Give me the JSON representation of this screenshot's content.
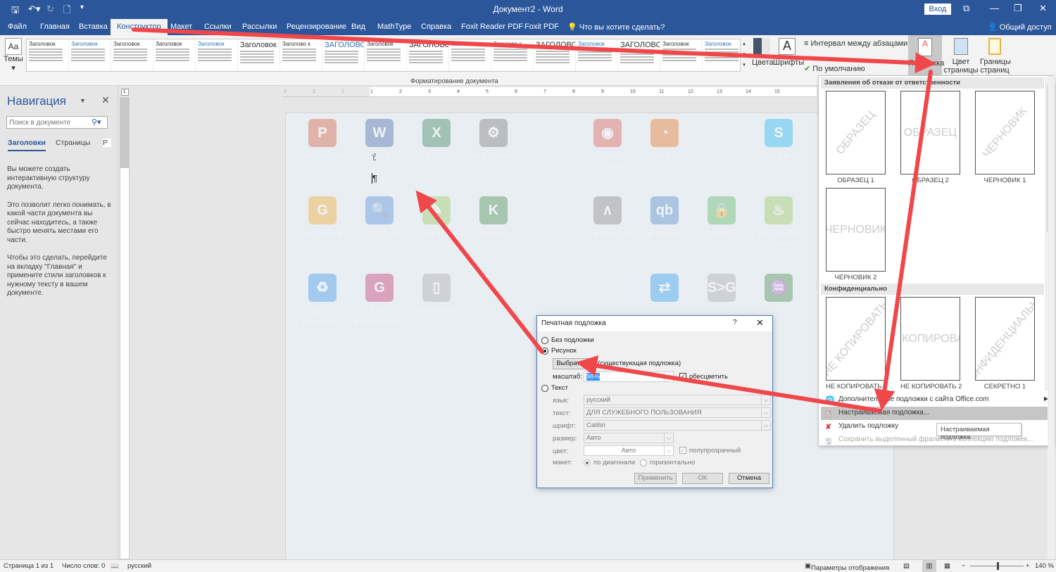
{
  "titlebar": {
    "title": "Документ2 - Word",
    "login": "Вход"
  },
  "tabs": [
    {
      "label": "Файл"
    },
    {
      "label": "Главная"
    },
    {
      "label": "Вставка"
    },
    {
      "label": "Конструктор",
      "active": true
    },
    {
      "label": "Макет"
    },
    {
      "label": "Ссылки"
    },
    {
      "label": "Рассылки"
    },
    {
      "label": "Рецензирование"
    },
    {
      "label": "Вид"
    },
    {
      "label": "MathType"
    },
    {
      "label": "Справка"
    },
    {
      "label": "Foxit Reader PDF"
    },
    {
      "label": "Foxit PDF"
    }
  ],
  "tell_me": "Что вы хотите сделать?",
  "share": "Общий доступ",
  "ribbon": {
    "themes": "Темы",
    "style_gallery": [
      "Заголовок",
      "Заголовок",
      "Заголовок",
      "Заголовок",
      "Заголовок",
      "Заголовок",
      "Заголово к",
      "ЗАГОЛОВО К",
      "Заголовок",
      "ЗАГОЛОВОК",
      "Заголовок",
      "Заголово к",
      "ЗАГОЛОВОК",
      "Заголовок",
      "ЗАГОЛОВОК",
      "Заголовок",
      "Заголовок"
    ],
    "colors": "Цвета",
    "fonts": "Шрифты",
    "paragraph_spacing": "Интервал между абзацами",
    "set_default": "По умолчанию",
    "watermark": "Подложка",
    "page_color": "Цвет страницы",
    "page_borders": "Границы страниц",
    "group_label": "Форматирование документа"
  },
  "nav": {
    "title": "Навигация",
    "search_placeholder": "Поиск в документе",
    "tabs": [
      "Заголовки",
      "Страницы",
      "Р"
    ],
    "help": [
      "Вы можете создать интерактивную структуру документа.",
      "Это позволит легко понимать, в какой части документа вы сейчас находитесь, а также быстро менять местами его части.",
      "Чтобы это сделать, перейдите на вкладку \"Главная\" и примените стили заголовков к нужному тексту в вашем документе."
    ]
  },
  "ruler_numbers": [
    "3",
    "2",
    "1",
    "1",
    "2",
    "3",
    "4",
    "5",
    "6",
    "7",
    "8",
    "9",
    "10",
    "11",
    "12",
    "13",
    "14",
    "15"
  ],
  "desktop_icons": [
    {
      "label": "PowerPoint",
      "glyph": "P",
      "color": "#d24726"
    },
    {
      "label": "Word",
      "glyph": "W",
      "color": "#2b579a"
    },
    {
      "label": "Excel",
      "glyph": "X",
      "color": "#217346"
    },
    {
      "label": "AirExplorer",
      "glyph": "⚙",
      "color": "#666666"
    },
    {
      "label": "Google Chrome",
      "glyph": "◉",
      "color": "#db4437"
    },
    {
      "label": "Firefox",
      "glyph": "◔",
      "color": "#e66000"
    },
    {
      "label": "Skype",
      "glyph": "S",
      "color": "#00aff0"
    },
    {
      "label": "Foxit Reader",
      "glyph": "G",
      "color": "#f39c12"
    },
    {
      "label": "STDU Viewer",
      "glyph": "🔍",
      "color": "#3b7dd8"
    },
    {
      "label": "Notepad",
      "glyph": "✎",
      "color": "#8bc34a"
    },
    {
      "label": "Kearan",
      "glyph": "K",
      "color": "#2e7d32"
    },
    {
      "label": "Graphing Calc",
      "glyph": "∧",
      "color": "#777777"
    },
    {
      "label": "qBittorrent",
      "glyph": "qb",
      "color": "#3a78c3"
    },
    {
      "label": "WinSCP",
      "glyph": "🔒",
      "color": "#4caf50"
    },
    {
      "label": "NETGEAR Genie",
      "glyph": "♨",
      "color": "#8bc34a"
    },
    {
      "label": "Wise Program...",
      "glyph": "♻",
      "color": "#1e88e5"
    },
    {
      "label": "Foxit PhantomPDF",
      "glyph": "G",
      "color": "#c2185b"
    },
    {
      "label": "LibreOffice 6.3",
      "glyph": "▯",
      "color": "#9e9e9e"
    },
    {
      "label": "",
      "glyph": "⇄",
      "color": "#0e8ee9"
    },
    {
      "label": "",
      "glyph": "S>G",
      "color": "#9e9e9e"
    },
    {
      "label": "",
      "glyph": "♒",
      "color": "#2e7d32"
    }
  ],
  "dialog": {
    "title": "Печатная подложка",
    "help": "?",
    "no_watermark": "Без подложки",
    "picture": "Рисунок",
    "select_button": "Выбрать...",
    "existing": "(существующая подложка)",
    "scale_label": "масштаб:",
    "scale_value": "98%",
    "washout": "обесцветить",
    "washout_checked": true,
    "text": "Текст",
    "language_label": "язык:",
    "language_value": "русский",
    "text_label": "текст:",
    "text_value": "ДЛЯ СЛУЖЕБНОГО ПОЛЬЗОВАНИЯ",
    "font_label": "шрифт:",
    "font_value": "Calibri",
    "size_label": "размер:",
    "size_value": "Авто",
    "color_label": "цвет:",
    "color_value": "Авто",
    "semitransparent": "полупрозрачный",
    "layout_label": "макет:",
    "diagonal": "по диагонали",
    "horizontal": "горизонтально",
    "apply": "Применить",
    "ok": "ОК",
    "cancel": "Отмена",
    "selected_option": "Рисунок"
  },
  "watermark_panel": {
    "section1": "Заявления об отказе от ответственности",
    "section2": "Конфиденциально",
    "items1": [
      {
        "caption": "ОБРАЗЕЦ 1",
        "text": "ОБРАЗЕЦ",
        "diag": true
      },
      {
        "caption": "ОБРАЗЕЦ 2",
        "text": "ОБРАЗЕЦ",
        "diag": false
      },
      {
        "caption": "ЧЕРНОВИК 1",
        "text": "ЧЕРНОВИК",
        "diag": true
      },
      {
        "caption": "ЧЕРНОВИК 2",
        "text": "ЧЕРНОВИК",
        "diag": false
      }
    ],
    "items2": [
      {
        "caption": "НЕ КОПИРОВАТЬ 1",
        "text": "НЕ КОПИРОВАТЬ",
        "diag": true
      },
      {
        "caption": "НЕ КОПИРОВАТЬ 2",
        "text": "НЕ КОПИРОВАТЬ",
        "diag": false
      },
      {
        "caption": "СЕКРЕТНО 1",
        "text": "КОНФИДЕНЦИАЛЬНО",
        "diag": true
      }
    ],
    "more": "Дополнительные подложки с сайта Office.com",
    "custom": "Настраиваемая подложка...",
    "remove": "Удалить подложку",
    "save": "Сохранить выделенный фрагмент в коллекцию подложек..."
  },
  "tooltip": "Настраиваемая подложка",
  "status": {
    "page": "Страница 1 из 1",
    "words": "Число слов: 0",
    "language": "русский",
    "display_settings": "Параметры отображения",
    "zoom": "140 %"
  },
  "colors": {
    "brand": "#2b579a",
    "arrow": "#f0474a"
  }
}
